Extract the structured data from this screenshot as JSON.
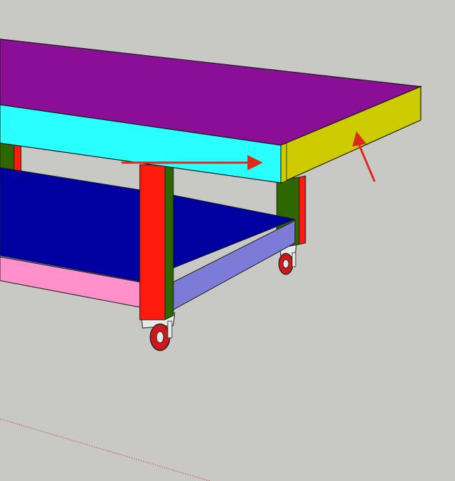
{
  "scene": {
    "background": "#c8c8c4",
    "outline": "#1a1a1a",
    "colors": {
      "tabletop": "#8a0e96",
      "front_apron": "#2affff",
      "side_apron": "#cccc00",
      "lower_shelf": "#0000a0",
      "shelf_front_rail": "#ff90cc",
      "shelf_side_rail": "#7c7cd8",
      "leg_face": "#ff1a0e",
      "leg_side": "#2e6600",
      "wheel": "#cc1a1a",
      "caster_metal": "#e8e8e8",
      "annotation_arrow": "#dd2a1a",
      "axis_guide": "#c04040"
    },
    "annotations": [
      {
        "points_to": "front_apron",
        "icon": "arrow-right-icon"
      },
      {
        "points_to": "side_apron",
        "icon": "arrow-up-left-icon"
      }
    ]
  }
}
